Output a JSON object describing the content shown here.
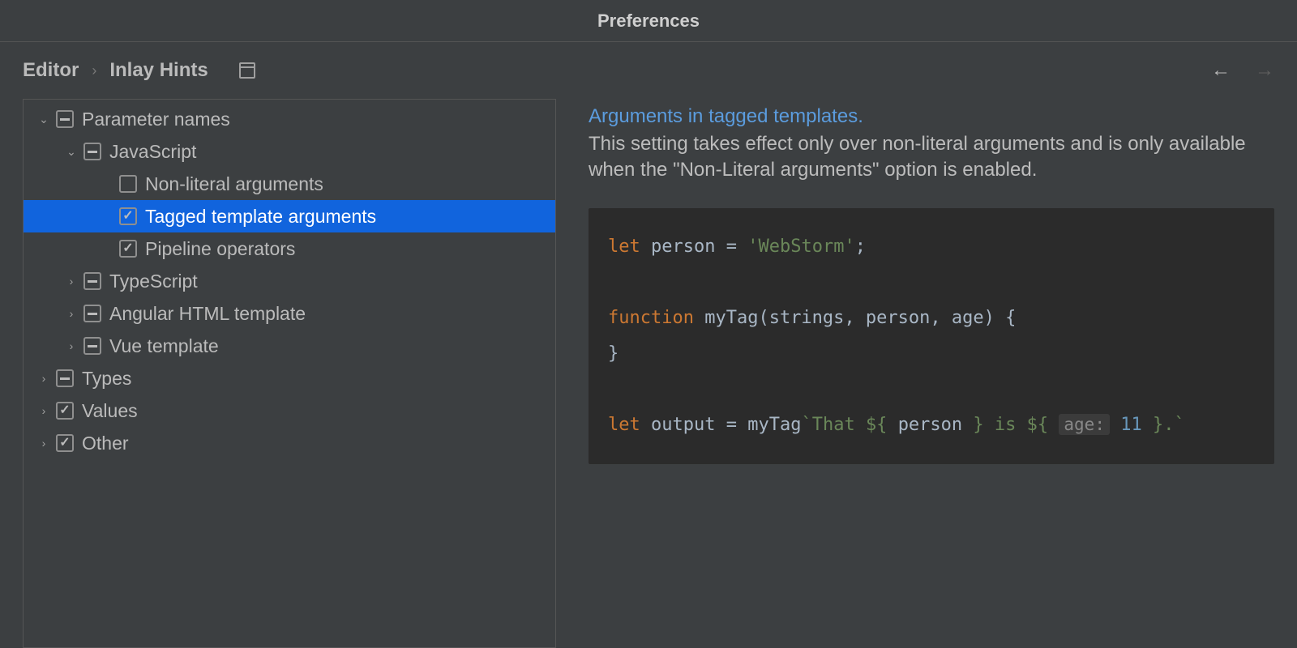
{
  "window": {
    "title": "Preferences"
  },
  "breadcrumb": {
    "parent": "Editor",
    "sep": "›",
    "current": "Inlay Hints"
  },
  "tree": {
    "parameter_names": "Parameter names",
    "javascript": "JavaScript",
    "non_literal_args": "Non-literal arguments",
    "tagged_template_args": "Tagged template arguments",
    "pipeline_operators": "Pipeline operators",
    "typescript": "TypeScript",
    "angular_html": "Angular HTML template",
    "vue_template": "Vue template",
    "types": "Types",
    "values": "Values",
    "other": "Other"
  },
  "detail": {
    "title": "Arguments in tagged templates.",
    "description": "This setting takes effect only over non-literal arguments and is only available when the \"Non-Literal arguments\" option is enabled."
  },
  "code": {
    "let1": "let",
    "person_decl": "person",
    "eq": "=",
    "person_val": "'WebStorm'",
    "semi": ";",
    "function_kw": "function",
    "fun_name": "myTag",
    "fun_params": "(strings, person, age) {",
    "close_brace": "}",
    "output_decl": "output",
    "mytag_call": "myTag",
    "tpl_open": "`That ${",
    "tpl_person": "person",
    "tpl_mid": "} is ${",
    "hint_label": "age:",
    "hint_value": "11",
    "tpl_close": "}.`"
  }
}
